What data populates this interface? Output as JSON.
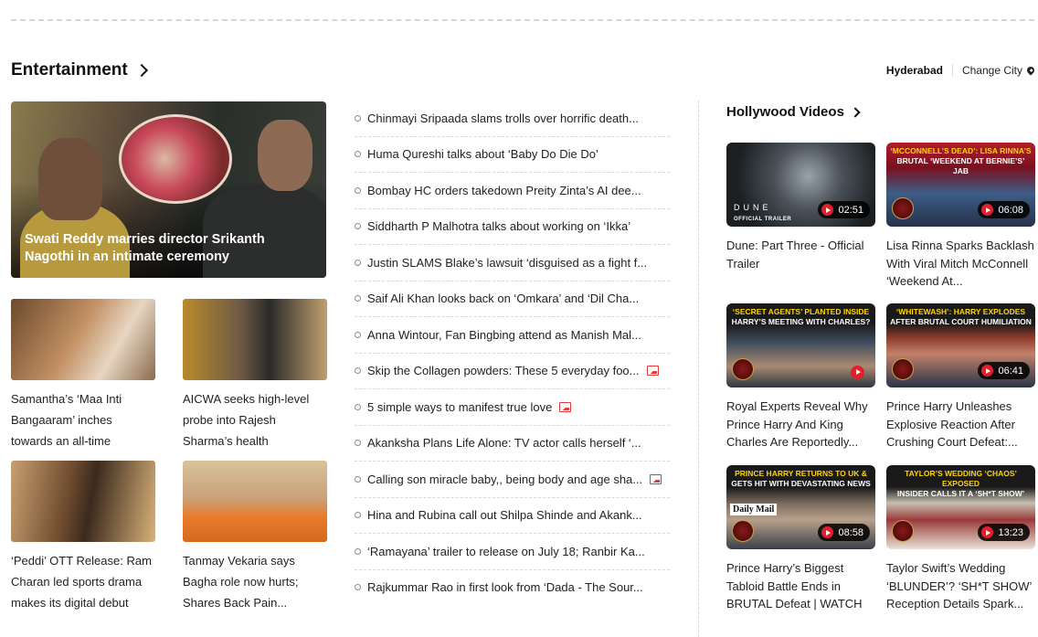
{
  "section": {
    "title": "Entertainment",
    "city_current": "Hyderabad",
    "city_change": "Change City"
  },
  "hero": {
    "caption": "Swati Reddy marries director Srikanth Nagothi in an intimate ceremony"
  },
  "cards": [
    {
      "title": "Samantha’s ‘Maa Inti Bangaaram’ inches towards an all-time"
    },
    {
      "title": "AICWA seeks high-level probe into Rajesh Sharma’s health"
    },
    {
      "title": "‘Peddi’ OTT Release: Ram Charan led sports drama makes its digital debut"
    },
    {
      "title": "Tanmay Vekaria says Bagha role now hurts; Shares Back Pain..."
    }
  ],
  "headlines": [
    {
      "text": "Chinmayi Sripaada slams trolls over horrific death...",
      "gallery": false
    },
    {
      "text": "Huma Qureshi talks about ‘Baby Do Die Do’",
      "gallery": false
    },
    {
      "text": "Bombay HC orders takedown Preity Zinta’s AI dee...",
      "gallery": false
    },
    {
      "text": "Siddharth P Malhotra talks about working on ‘Ikka’",
      "gallery": false
    },
    {
      "text": "Justin SLAMS Blake’s lawsuit ‘disguised as a fight f...",
      "gallery": false
    },
    {
      "text": "Saif Ali Khan looks back on ‘Omkara’ and ‘Dil Cha...",
      "gallery": false
    },
    {
      "text": "Anna Wintour, Fan Bingbing attend as Manish Mal...",
      "gallery": false
    },
    {
      "text": "Skip the Collagen powders: These 5 everyday foo...",
      "gallery": true
    },
    {
      "text": "5 simple ways to manifest true love",
      "gallery": true
    },
    {
      "text": "Akanksha Plans Life Alone: TV actor calls herself ‘...",
      "gallery": false
    },
    {
      "text": "Calling son miracle baby,, being body and age sha...",
      "gallery": true
    },
    {
      "text": "Hina and Rubina call out Shilpa Shinde and Akank...",
      "gallery": false
    },
    {
      "text": "‘Ramayana’ trailer to release on July 18; Ranbir Ka...",
      "gallery": false
    },
    {
      "text": "Rajkummar Rao in first look from ‘Dada - The Sour...",
      "gallery": false
    }
  ],
  "videos": {
    "title": "Hollywood Videos",
    "items": [
      {
        "title": "Dune: Part Three - Official Trailer",
        "duration": "02:51",
        "logo_text": "DUNE",
        "logo_sub": "OFFICIAL TRAILER"
      },
      {
        "title": "Lisa Rinna Sparks Backlash With Viral Mitch McConnell ‘Weekend At...",
        "duration": "06:08",
        "banner_a": "‘McConnell’s Dead’: Lisa Rinna’s",
        "banner_b": "Brutal ‘Weekend at Bernie’s’ Jab"
      },
      {
        "title": "Royal Experts Reveal Why Prince Harry And King Charles Are Reportedly...",
        "duration": "",
        "banner_a": "‘Secret Agents’ Planted Inside",
        "banner_b": "Harry’s Meeting with Charles?"
      },
      {
        "title": "Prince Harry Unleashes Explosive Reaction After Crushing Court Defeat:...",
        "duration": "06:41",
        "banner_a": "‘Whitewash’: Harry Explodes",
        "banner_b": "After Brutal Court Humiliation"
      },
      {
        "title": "Prince Harry’s Biggest Tabloid Battle Ends in BRUTAL Defeat | WATCH",
        "duration": "08:58",
        "banner_a": "Prince Harry Returns to UK &",
        "banner_b": "Gets Hit with Devastating News",
        "paper": "Daily Mail"
      },
      {
        "title": "Taylor Swift’s Wedding ‘BLUNDER’? ‘SH*T SHOW’ Reception Details Spark...",
        "duration": "13:23",
        "banner_a": "Taylor’s Wedding ‘Chaos’ Exposed",
        "banner_b": "Insider Calls It A ‘SH*T SHOW’"
      }
    ]
  }
}
